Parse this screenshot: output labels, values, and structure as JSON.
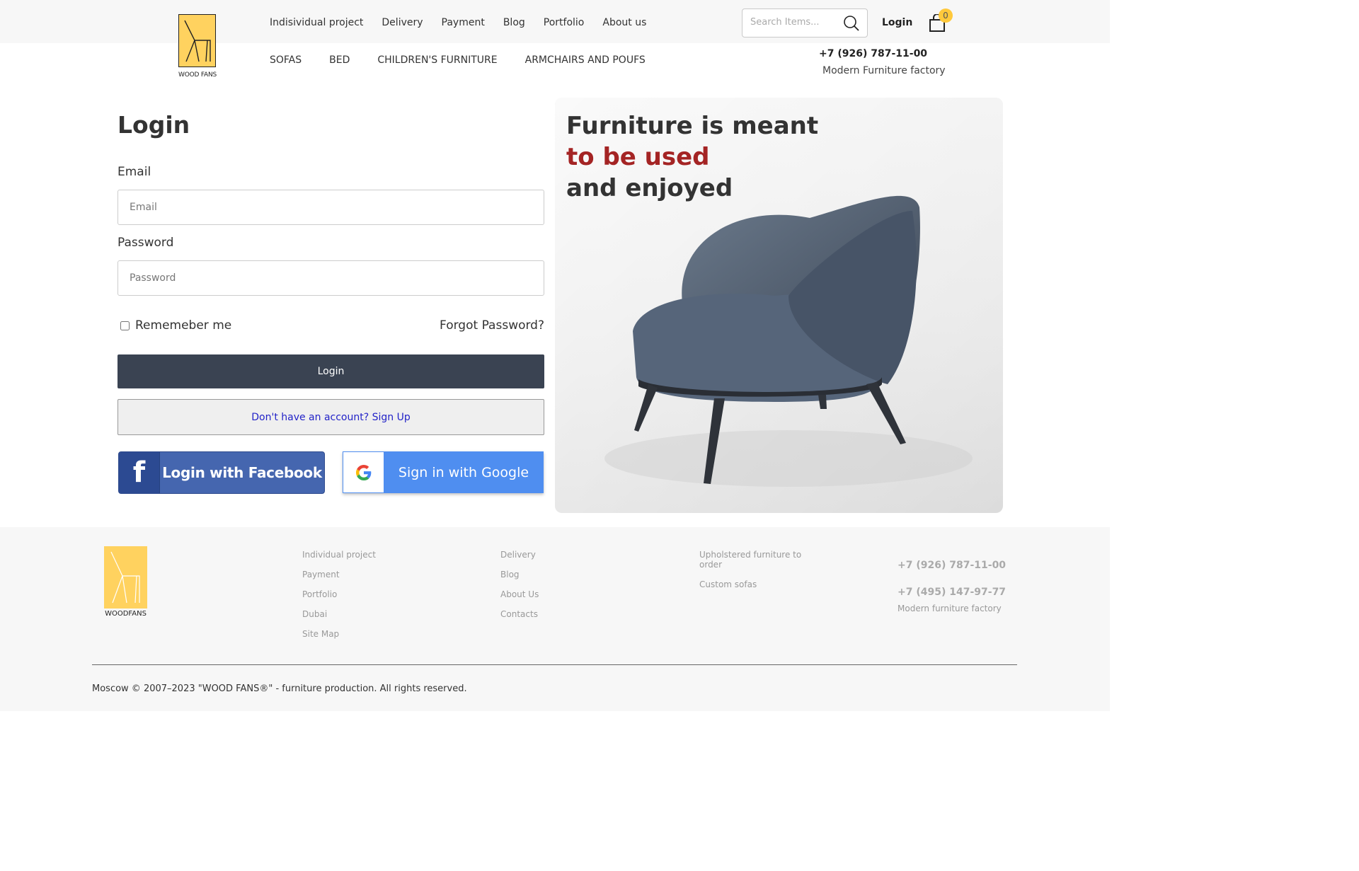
{
  "brand": {
    "logo_text": "WOOD FANS",
    "footer_logo_text": "WOODFANS"
  },
  "topnav": [
    "Indisividual project",
    "Delivery",
    "Payment",
    "Blog",
    "Portfolio",
    "About us"
  ],
  "search": {
    "placeholder": "Search Items..."
  },
  "header": {
    "login_label": "Login",
    "cart_count": "0",
    "phone": "+7 (926) 787-11-00",
    "factory": "Modern Furniture factory"
  },
  "categories": [
    "SOFAS",
    "BED",
    "CHILDREN'S FURNITURE",
    "ARMCHAIRS AND POUFS"
  ],
  "form": {
    "title": "Login",
    "email_label": "Email",
    "email_placeholder": "Email",
    "password_label": "Password",
    "password_placeholder": "Password",
    "remember_label": "Rememeber me",
    "forgot_label": "Forgot Password?",
    "login_button": "Login",
    "signup_button": "Don't have an account? Sign Up",
    "facebook_button": "Login with Facebook",
    "google_button": "Sign in with Google"
  },
  "hero": {
    "line1": "Furniture is meant",
    "line2": "to be used",
    "line3": "and enjoyed"
  },
  "footer": {
    "col1": [
      "Individual project",
      "Payment",
      "Portfolio",
      "Dubai",
      "Site Map"
    ],
    "col2": [
      "Delivery",
      "Blog",
      "About Us",
      "Contacts"
    ],
    "col3": [
      "Upholstered furniture to order",
      "Custom sofas"
    ],
    "phone1": "+7 (926) 787-11-00",
    "phone2": "+7 (495) 147-97-77",
    "factory": "Modern furniture factory",
    "copyright": "Moscow © 2007–2023 \"WOOD FANS®\" - furniture production. All rights reserved."
  },
  "colors": {
    "accent": "#ffd25f",
    "login_button": "#3a4352",
    "hero_red": "#a42424",
    "facebook": "#4566af",
    "google": "#4f8ef0"
  }
}
